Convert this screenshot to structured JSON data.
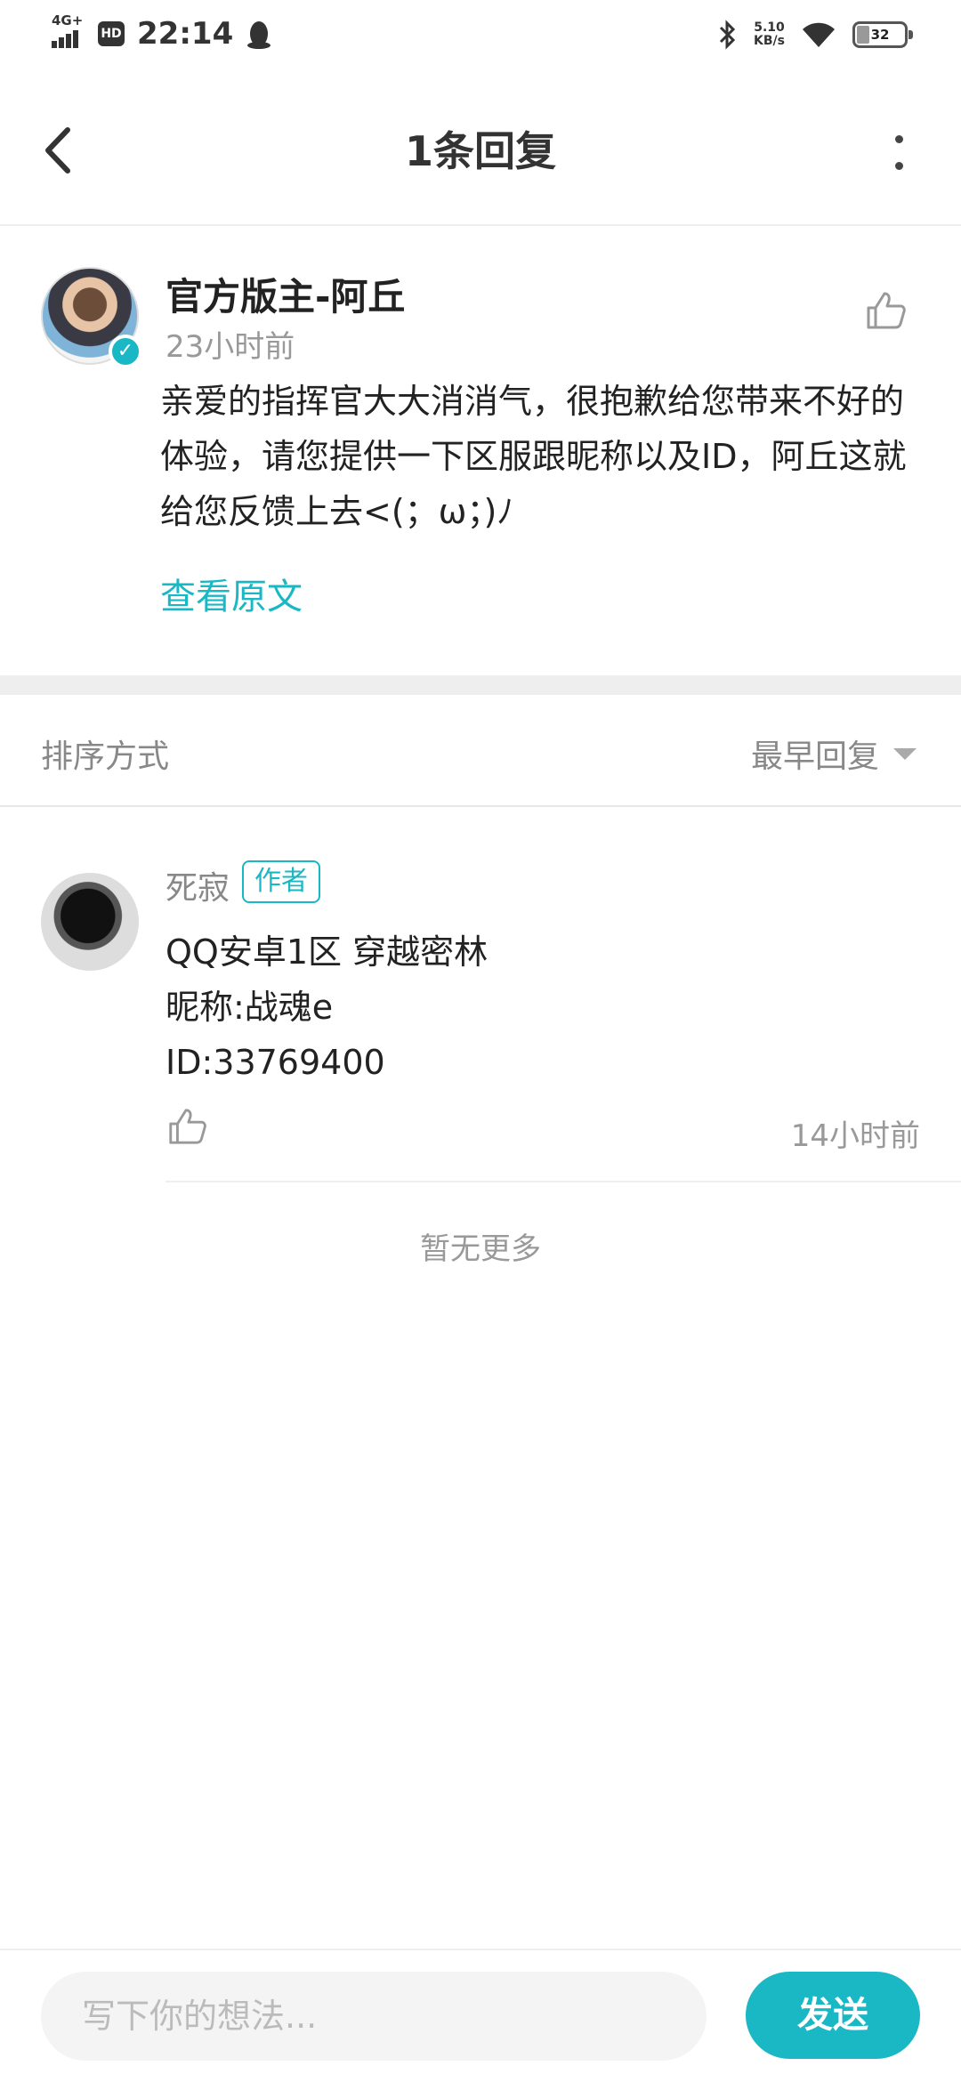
{
  "status_bar": {
    "network": "4G+",
    "hd": "HD",
    "time": "22:14",
    "speed_value": "5.10",
    "speed_unit": "KB/s",
    "battery": "32"
  },
  "header": {
    "title": "1条回复"
  },
  "post": {
    "author": "官方版主-阿丘",
    "time": "23小时前",
    "content": "亲爱的指挥官大大消消气，很抱歉给您带来不好的体验，请您提供一下区服跟昵称以及ID，阿丘这就给您反馈上去<(；ω；)ﾉ",
    "view_original": "查看原文"
  },
  "sort": {
    "label": "排序方式",
    "selected": "最早回复"
  },
  "reply": {
    "author": "死寂",
    "badge": "作者",
    "lines": [
      "QQ安卓1区 穿越密林",
      "昵称:战魂e",
      "ID:33769400"
    ],
    "time": "14小时前"
  },
  "footer_note": "暂无更多",
  "composer": {
    "placeholder": "写下你的想法...",
    "send_label": "发送"
  },
  "colors": {
    "accent": "#1ab7c4",
    "muted_text": "#999999"
  }
}
